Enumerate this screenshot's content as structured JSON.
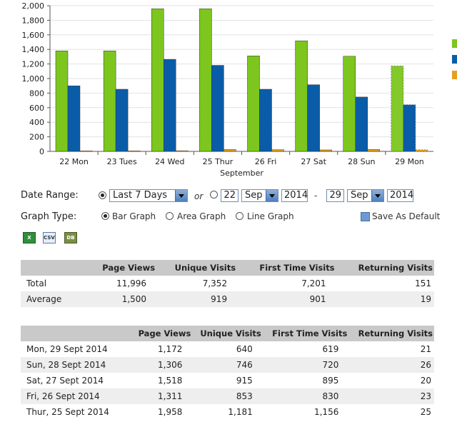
{
  "chart_data": {
    "type": "bar",
    "categories": [
      "22 Mon",
      "23 Tues",
      "24 Wed",
      "25 Thur",
      "26 Fri",
      "27 Sat",
      "28 Sun",
      "29 Mon"
    ],
    "xlabel": "September",
    "ylim": [
      0,
      2000
    ],
    "yticks": [
      "0",
      "200",
      "400",
      "600",
      "800",
      "1,000",
      "1,200",
      "1,400",
      "1,600",
      "1,800",
      "2,000"
    ],
    "series": [
      {
        "values": [
          1380,
          1380,
          1958,
          1958,
          1311,
          1518,
          1306,
          1172
        ],
        "color": "#7cc61e"
      },
      {
        "values": [
          900,
          853,
          1264,
          1181,
          853,
          915,
          746,
          640
        ],
        "color": "#0a5ca8"
      },
      {
        "values": [
          8,
          8,
          9,
          25,
          23,
          20,
          26,
          21
        ],
        "color": "#e6a020"
      }
    ],
    "last_bar_partial": true
  },
  "controls": {
    "date_range_label": "Date Range:",
    "range_select": "Last 7 Days",
    "or_label": "or",
    "from_day": "22",
    "from_month": "Sep",
    "from_year": "2014",
    "dash": "-",
    "to_day": "29",
    "to_month": "Sep",
    "to_year": "2014",
    "graph_type_label": "Graph Type:",
    "bar_graph": "Bar Graph",
    "area_graph": "Area Graph",
    "line_graph": "Line Graph",
    "save_default": "Save As Default",
    "export_icons": [
      "excel-icon",
      "csv-icon",
      "database-icon"
    ],
    "csv_text": "CSV"
  },
  "summary": {
    "headers": [
      "",
      "Page Views",
      "Unique Visits",
      "First Time Visits",
      "Returning Visits"
    ],
    "rows": [
      [
        "Total",
        "11,996",
        "7,352",
        "7,201",
        "151"
      ],
      [
        "Average",
        "1,500",
        "919",
        "901",
        "19"
      ]
    ]
  },
  "daily": {
    "headers": [
      "",
      "Page Views",
      "Unique Visits",
      "First Time Visits",
      "Returning Visits"
    ],
    "rows": [
      [
        "Mon, 29 Sept 2014",
        "1,172",
        "640",
        "619",
        "21"
      ],
      [
        "Sun, 28 Sept 2014",
        "1,306",
        "746",
        "720",
        "26"
      ],
      [
        "Sat, 27 Sept 2014",
        "1,518",
        "915",
        "895",
        "20"
      ],
      [
        "Fri, 26 Sept 2014",
        "1,311",
        "853",
        "830",
        "23"
      ],
      [
        "Thur, 25 Sept 2014",
        "1,958",
        "1,181",
        "1,156",
        "25"
      ]
    ]
  }
}
